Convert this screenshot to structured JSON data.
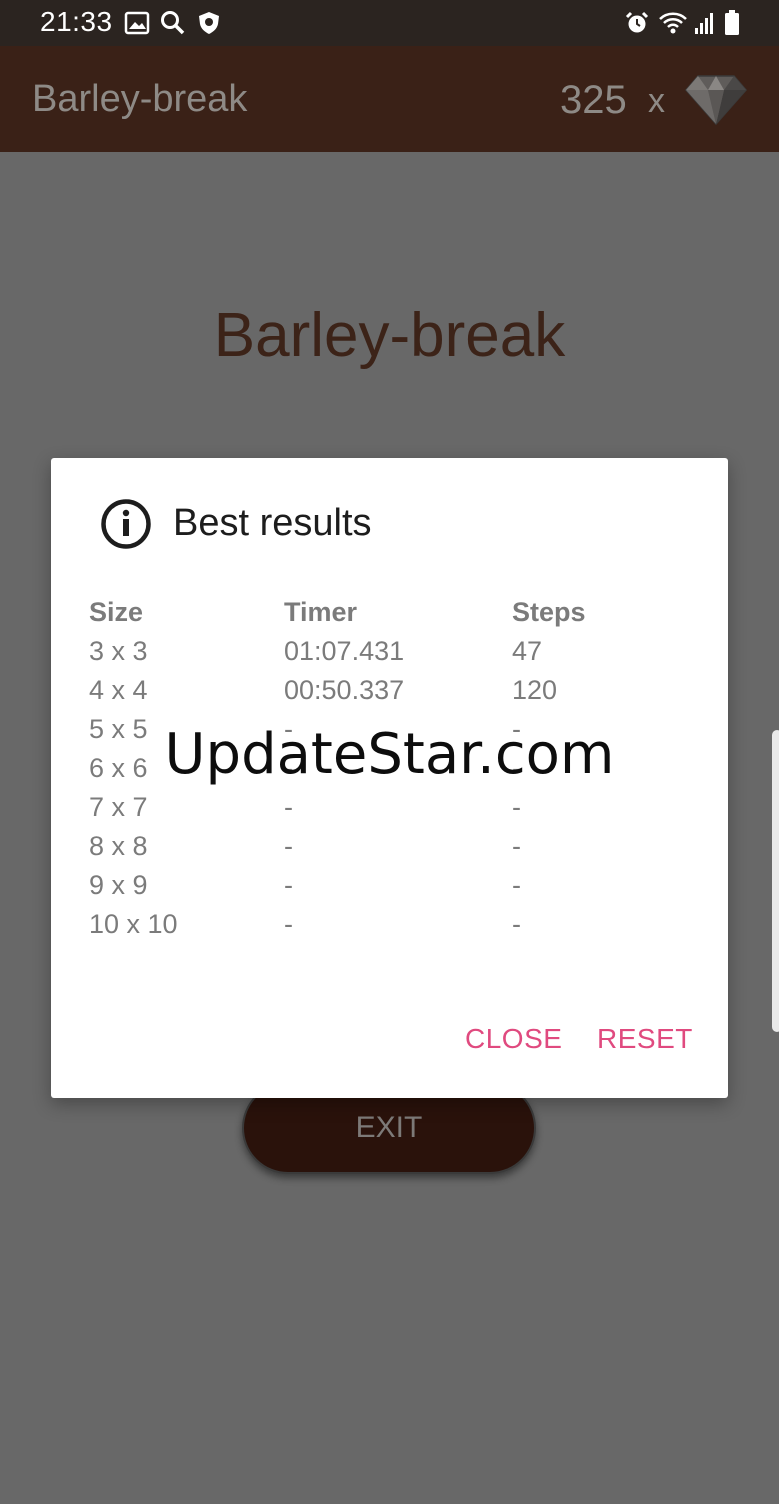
{
  "status_bar": {
    "time": "21:33",
    "left_icons": [
      "image-icon",
      "search-icon",
      "shield-icon"
    ],
    "right_icons": [
      "alarm-icon",
      "wifi-icon",
      "signal-icon",
      "battery-icon"
    ]
  },
  "app_bar": {
    "title": "Barley-break",
    "gem_count": "325",
    "gem_multiplier": "x",
    "gem_icon": "diamond-icon"
  },
  "main": {
    "title": "Barley-break",
    "exit_label": "EXIT"
  },
  "dialog": {
    "icon": "info-icon",
    "title": "Best results",
    "headers": {
      "size": "Size",
      "timer": "Timer",
      "steps": "Steps"
    },
    "rows": [
      {
        "size": "3 x 3",
        "timer": "01:07.431",
        "steps": "47"
      },
      {
        "size": "4 x 4",
        "timer": "00:50.337",
        "steps": "120"
      },
      {
        "size": "5 x 5",
        "timer": "-",
        "steps": "-"
      },
      {
        "size": "6 x 6",
        "timer": "-",
        "steps": "-"
      },
      {
        "size": "7 x 7",
        "timer": "-",
        "steps": "-"
      },
      {
        "size": "8 x 8",
        "timer": "-",
        "steps": "-"
      },
      {
        "size": "9 x 9",
        "timer": "-",
        "steps": "-"
      },
      {
        "size": "10 x 10",
        "timer": "-",
        "steps": "-"
      }
    ],
    "buttons": {
      "close": "CLOSE",
      "reset": "RESET"
    },
    "accent_color": "#e04a7f"
  },
  "watermark": "UpdateStar.com"
}
